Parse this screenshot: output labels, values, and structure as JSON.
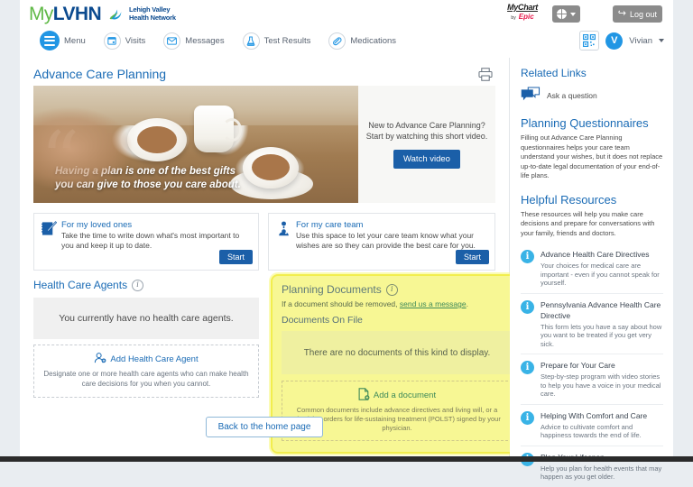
{
  "header": {
    "logo_my": "My",
    "logo_lvhn": "LVHN",
    "org_line1": "Lehigh Valley",
    "org_line2": "Health Network",
    "mychart_line1": "MyChart",
    "mychart_by": "by",
    "mychart_line2": "Epic",
    "globe_label": "",
    "logout_label": "Log out",
    "logout_icon": "logout-icon",
    "globe_icon": "globe-icon"
  },
  "nav": {
    "items": [
      {
        "label": "Menu",
        "icon": "hamburger-menu-icon"
      },
      {
        "label": "Visits",
        "icon": "calendar-icon"
      },
      {
        "label": "Messages",
        "icon": "envelope-icon"
      },
      {
        "label": "Test Results",
        "icon": "flask-icon"
      },
      {
        "label": "Medications",
        "icon": "pills-icon"
      }
    ],
    "qr_icon": "qr-code-icon",
    "avatar_initial": "V",
    "account_name": "Vivian"
  },
  "main": {
    "page_title": "Advance Care Planning",
    "print_icon": "printer-icon",
    "hero": {
      "quote": "Having a plan is one of the best gifts you can give to those you care about.",
      "promo_text": "New to Advance Care Planning? Start by watching this short video.",
      "promo_button": "Watch video"
    },
    "cards": [
      {
        "title": "For my loved ones",
        "desc": "Take the time to write down what's most important to you and keep it up to date.",
        "button": "Start",
        "icon": "notepad-pen-icon"
      },
      {
        "title": "For my care team",
        "desc": "Use this space to let your care team know what your wishes are so they can provide the best care for you.",
        "button": "Start",
        "icon": "care-team-person-icon"
      }
    ],
    "health_care_agents": {
      "heading": "Health Care Agents",
      "info_icon": "info-icon",
      "empty_text": "You currently have no health care agents.",
      "add_link": "Add Health Care Agent",
      "add_icon": "add-person-icon",
      "note": "Designate one or more health care agents who can make health care decisions for you when you cannot."
    },
    "planning_documents": {
      "heading": "Planning Documents",
      "info_icon": "info-icon",
      "removal_text_before": "If a document should be removed, ",
      "removal_link": "send us a message",
      "removal_text_after": ".",
      "subheading": "Documents On File",
      "empty_text": "There are no documents of this kind to display.",
      "add_link": "Add a document",
      "add_icon": "add-document-icon",
      "note": "Common documents include advance directives and living will, or a physician orders for life-sustaining treatment (POLST) signed by your physician."
    },
    "back_button": "Back to the home page"
  },
  "sidebar": {
    "related_links_heading": "Related Links",
    "ask_question_label": "Ask a question",
    "ask_question_icon": "speech-bubbles-icon",
    "questionnaires_heading": "Planning Questionnaires",
    "questionnaires_text": "Filling out Advance Care Planning questionnaires helps your care team understand your wishes, but it does not replace up-to-date legal documentation of your end-of-life plans.",
    "resources_heading": "Helpful Resources",
    "resources_intro": "These resources will help you make care decisions and prepare for conversations with your family, friends and doctors.",
    "resources": [
      {
        "title": "Advance Health Care Directives",
        "desc": "Your choices for medical care are important - even if you cannot speak for yourself.",
        "icon": "info-circle-icon"
      },
      {
        "title": "Pennsylvania Advance Health Care Directive",
        "desc": "This form lets you have a say about how you want to be treated if you get very sick.",
        "icon": "info-circle-icon"
      },
      {
        "title": "Prepare for Your Care",
        "desc": "Step-by-step program with video stories to help you have a voice in your medical care.",
        "icon": "info-circle-icon"
      },
      {
        "title": "Helping With Comfort and Care",
        "desc": "Advice to cultivate comfort and happiness towards the end of life.",
        "icon": "info-circle-icon"
      },
      {
        "title": "Plan Your Lifespan",
        "desc": "Help you plan for health events that may happen as you get older.",
        "icon": "info-circle-icon"
      }
    ]
  },
  "colors": {
    "brand_blue": "#0b4a8f",
    "brand_green": "#5fb946",
    "link_blue": "#1a6bb5",
    "button_blue": "#1b5fa8",
    "accent_cyan": "#39b3e6",
    "highlight_yellow": "#f7f794",
    "page_bg": "#e9edf1"
  }
}
